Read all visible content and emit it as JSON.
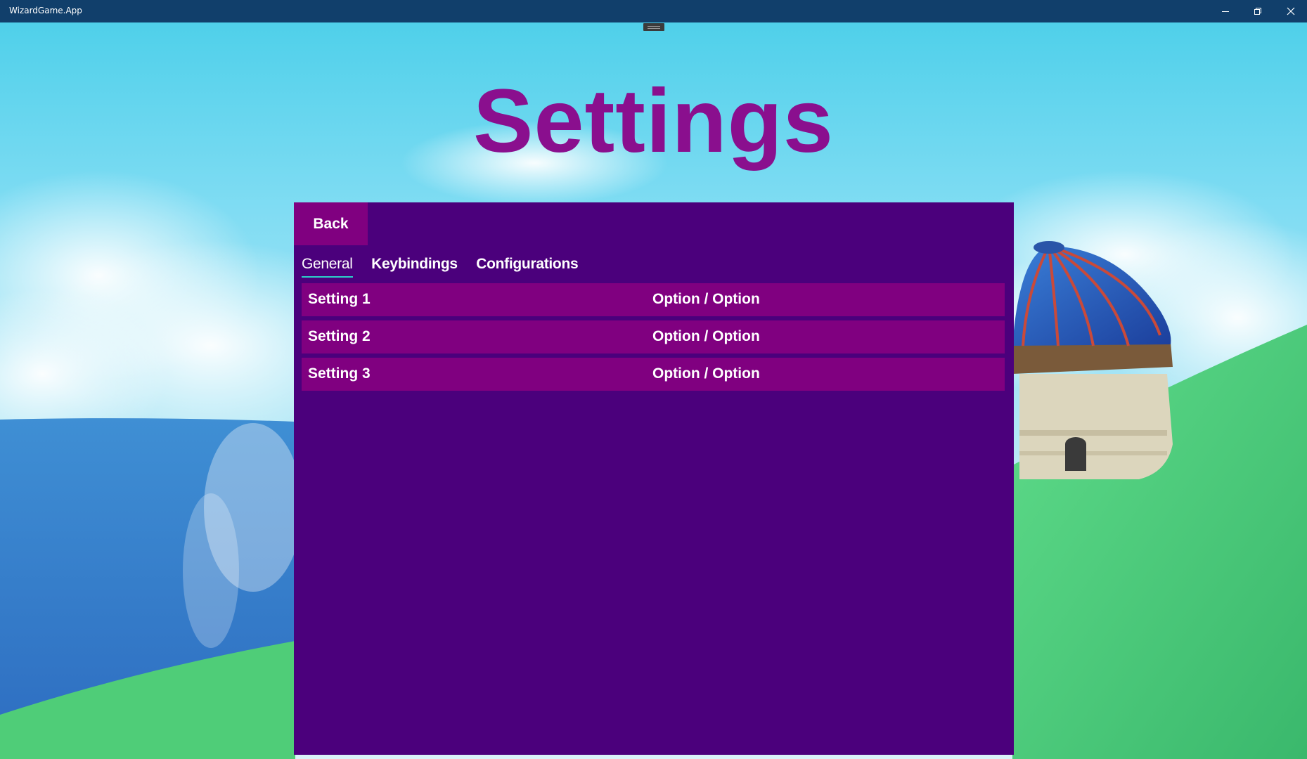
{
  "window": {
    "title": "WizardGame.App",
    "icons": [
      "minimize-icon",
      "maximize-icon",
      "close-icon"
    ]
  },
  "page": {
    "title": "Settings"
  },
  "panel": {
    "back_label": "Back",
    "tabs": [
      {
        "label": "General",
        "active": true
      },
      {
        "label": "Keybindings",
        "active": false
      },
      {
        "label": "Configurations",
        "active": false
      }
    ],
    "settings": [
      {
        "name": "Setting 1",
        "value": "Option / Option"
      },
      {
        "name": "Setting 2",
        "value": "Option / Option"
      },
      {
        "name": "Setting 3",
        "value": "Option / Option"
      }
    ]
  },
  "colors": {
    "titlebar": "#113f6b",
    "heading": "#8a0f8e",
    "panel": "#4b007c",
    "row": "#800080",
    "tab_underline": "#2bd1c9"
  }
}
